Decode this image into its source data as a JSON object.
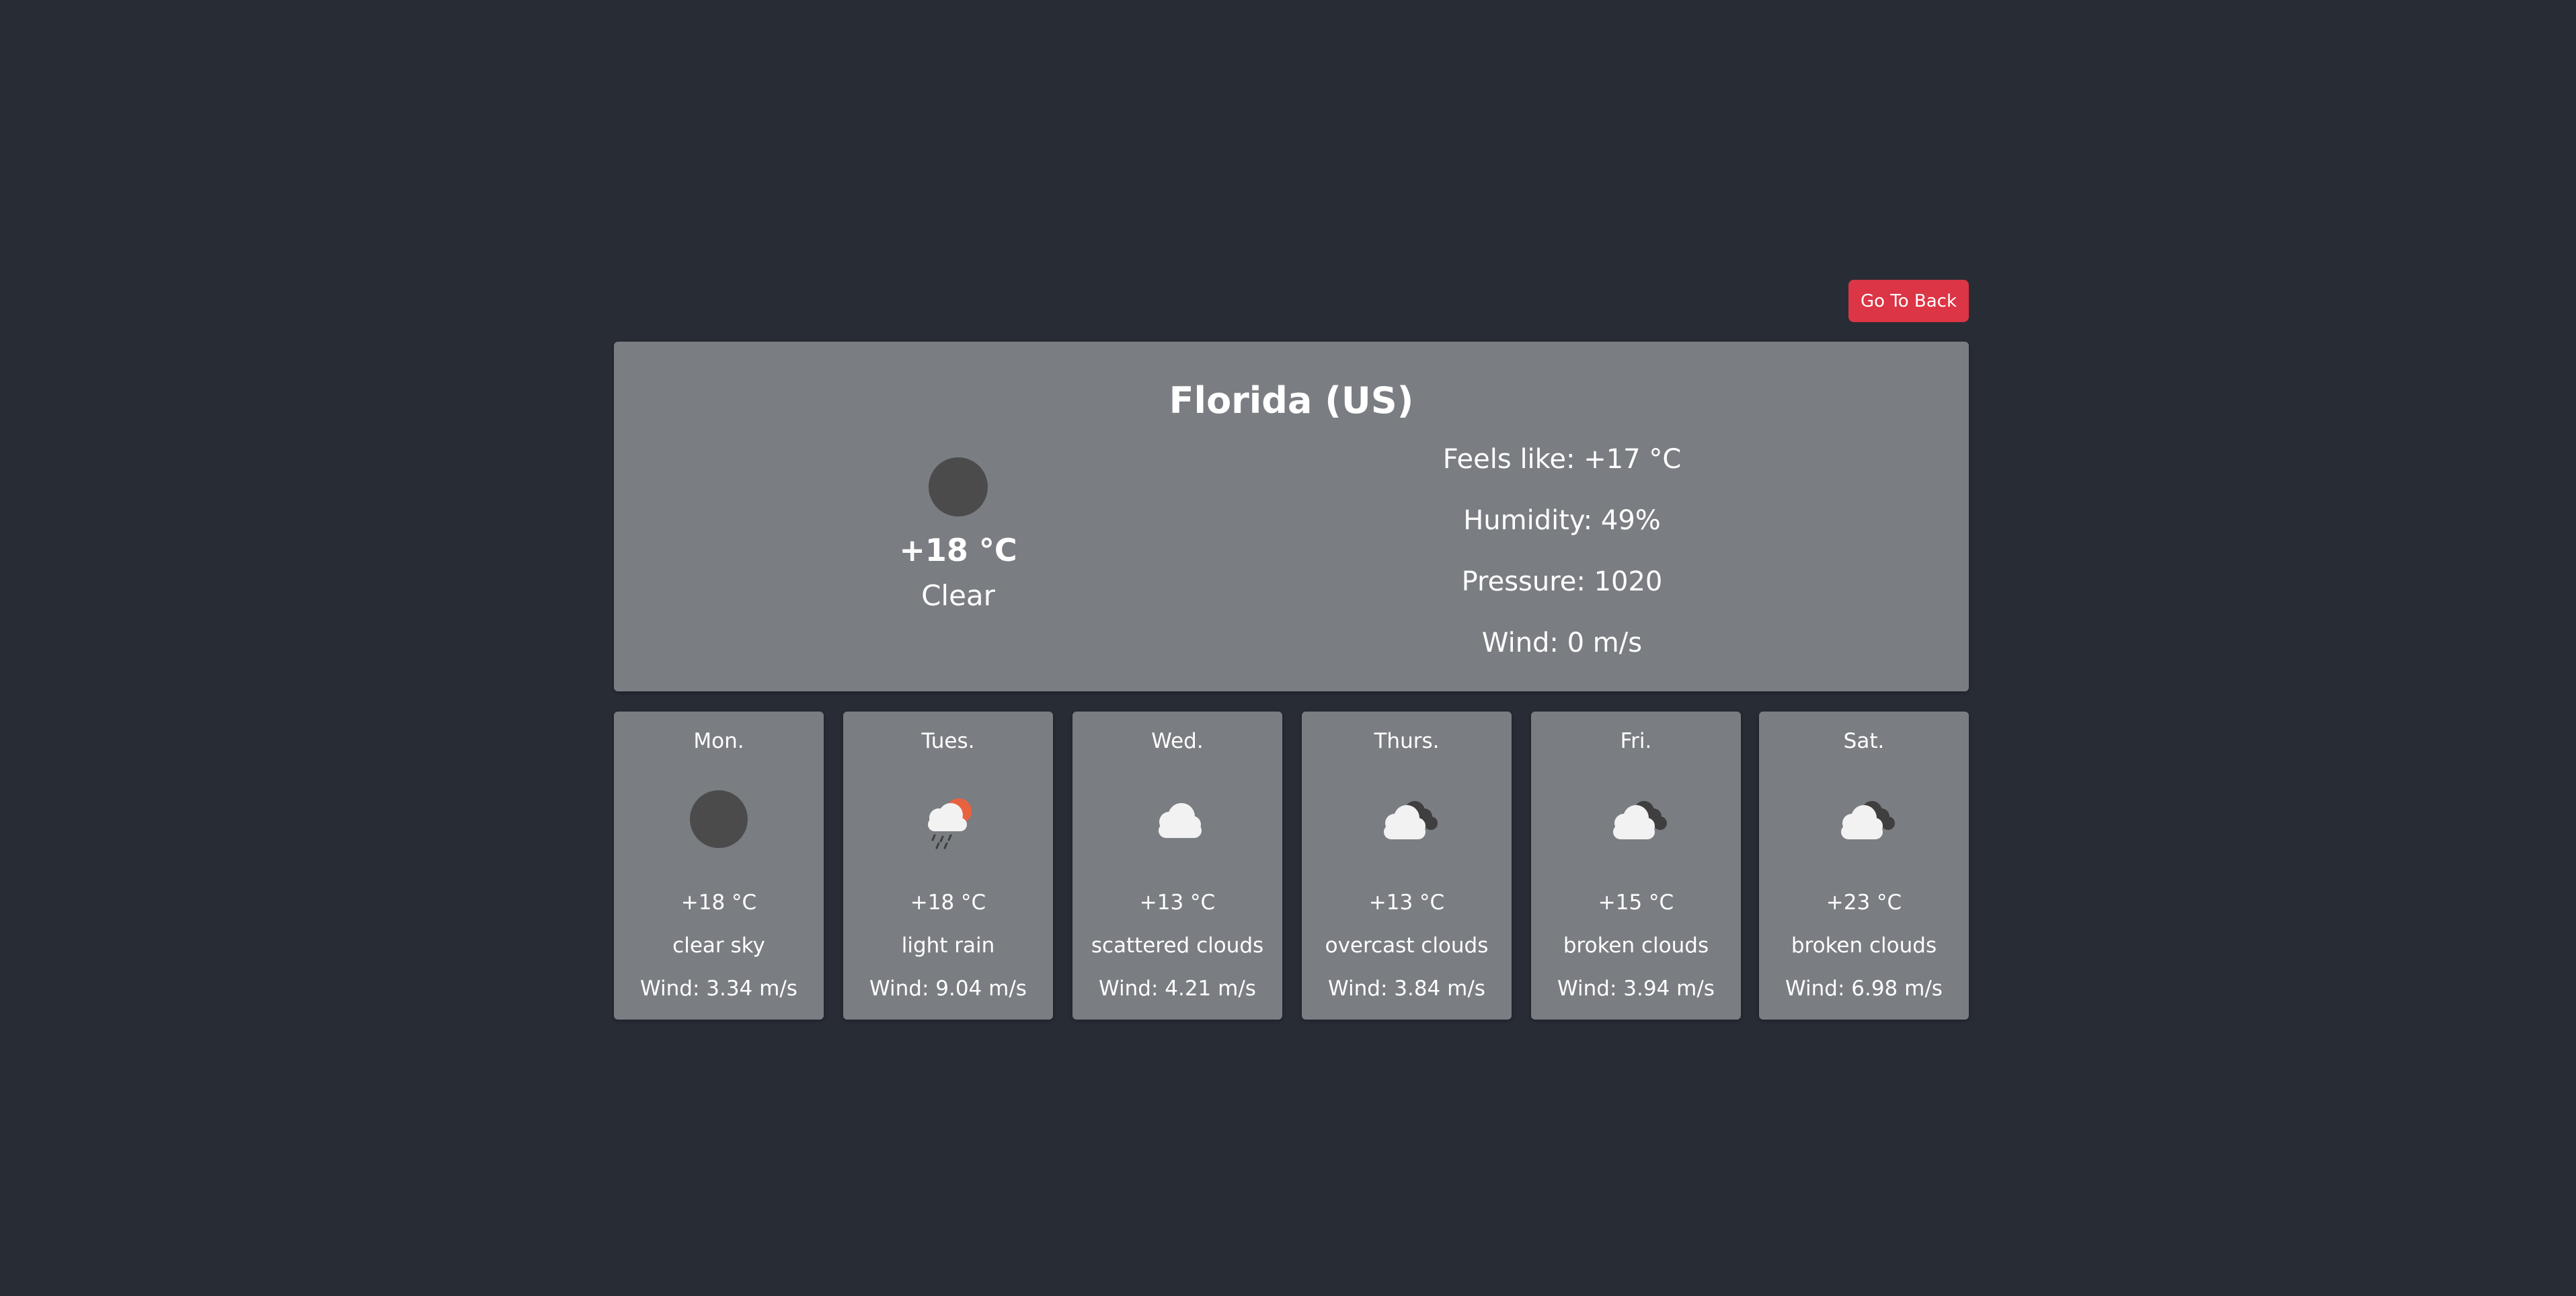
{
  "header": {
    "back_label": "Go To Back",
    "back_color": "#dc3545"
  },
  "current": {
    "location": "Florida (US)",
    "icon": "clear-sky-icon",
    "temperature": "+18 °C",
    "condition": "Clear",
    "feels_like": "Feels like: +17 °C",
    "humidity": "Humidity: 49%",
    "pressure": "Pressure: 1020",
    "wind": "Wind: 0 m/s"
  },
  "forecast": [
    {
      "day": "Mon.",
      "icon": "clear-sky-icon",
      "temperature": "+18 °C",
      "description": "clear sky",
      "wind": "Wind: 3.34 m/s"
    },
    {
      "day": "Tues.",
      "icon": "light-rain-icon",
      "temperature": "+18 °C",
      "description": "light rain",
      "wind": "Wind: 9.04 m/s"
    },
    {
      "day": "Wed.",
      "icon": "scattered-clouds-icon",
      "temperature": "+13 °C",
      "description": "scattered clouds",
      "wind": "Wind: 4.21 m/s"
    },
    {
      "day": "Thurs.",
      "icon": "overcast-clouds-icon",
      "temperature": "+13 °C",
      "description": "overcast clouds",
      "wind": "Wind: 3.84 m/s"
    },
    {
      "day": "Fri.",
      "icon": "broken-clouds-icon",
      "temperature": "+15 °C",
      "description": "broken clouds",
      "wind": "Wind: 3.94 m/s"
    },
    {
      "day": "Sat.",
      "icon": "broken-clouds-icon",
      "temperature": "+23 °C",
      "description": "broken clouds",
      "wind": "Wind: 6.98 m/s"
    }
  ],
  "colors": {
    "background": "#282c35",
    "card": "#7a7d82",
    "sun": "#e8623f",
    "cloud_light": "#f2f2f2",
    "cloud_dark": "#3f3f3f"
  }
}
